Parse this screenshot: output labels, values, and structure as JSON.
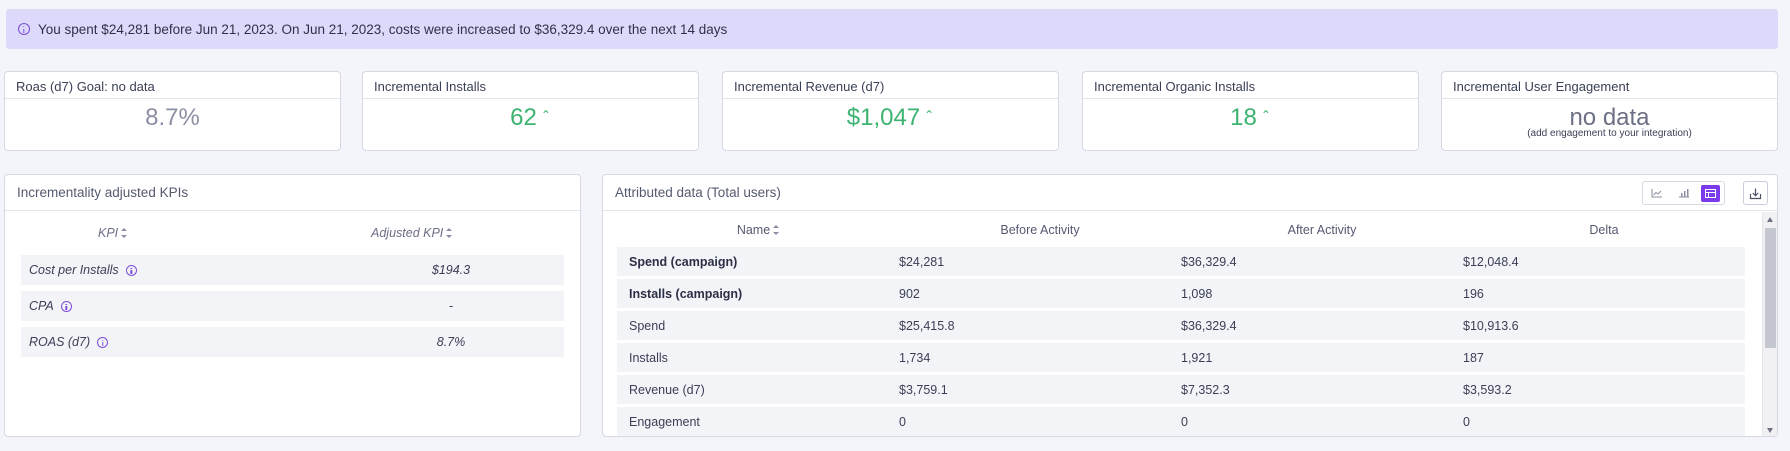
{
  "banner": {
    "text": "You spent $24,281 before Jun 21, 2023. On Jun 21, 2023, costs were increased to $36,329.4 over the next 14 days"
  },
  "cards": [
    {
      "title": "Roas (d7) Goal: no data",
      "value": "8.7%",
      "trend": ""
    },
    {
      "title": "Incremental Installs",
      "value": "62",
      "trend": "up"
    },
    {
      "title": "Incremental Revenue (d7)",
      "value": "$1,047",
      "trend": "up"
    },
    {
      "title": "Incremental Organic Installs",
      "value": "18",
      "trend": "up"
    },
    {
      "title": "Incremental User Engagement",
      "value": "no data",
      "note": "(add engagement to your integration)"
    }
  ],
  "kpi_panel": {
    "title": "Incrementality adjusted KPIs",
    "columns": [
      "KPI",
      "Adjusted KPI"
    ],
    "rows": [
      {
        "kpi": "Cost per Installs",
        "value": "$194.3"
      },
      {
        "kpi": "CPA",
        "value": "-"
      },
      {
        "kpi": "ROAS (d7)",
        "value": "8.7%"
      }
    ]
  },
  "attributed_panel": {
    "title": "Attributed data (Total users)",
    "columns": [
      "Name",
      "Before Activity",
      "After Activity",
      "Delta"
    ],
    "rows": [
      {
        "name": "Spend (campaign)",
        "before": "$24,281",
        "after": "$36,329.4",
        "delta": "$12,048.4",
        "bold": true
      },
      {
        "name": "Installs (campaign)",
        "before": "902",
        "after": "1,098",
        "delta": "196",
        "bold": true
      },
      {
        "name": "Spend",
        "before": "$25,415.8",
        "after": "$36,329.4",
        "delta": "$10,913.6",
        "bold": false
      },
      {
        "name": "Installs",
        "before": "1,734",
        "after": "1,921",
        "delta": "187",
        "bold": false
      },
      {
        "name": "Revenue (d7)",
        "before": "$3,759.1",
        "after": "$7,352.3",
        "delta": "$3,593.2",
        "bold": false
      },
      {
        "name": "Engagement",
        "before": "0",
        "after": "0",
        "delta": "0",
        "bold": false
      }
    ],
    "toolbar": {
      "icons": [
        "line-chart-icon",
        "bar-chart-icon",
        "table-view-icon"
      ],
      "active": "table-view-icon"
    }
  },
  "colors": {
    "accent": "#7c3aed",
    "positive": "#3cb371",
    "banner_bg": "#dcd9fb"
  }
}
